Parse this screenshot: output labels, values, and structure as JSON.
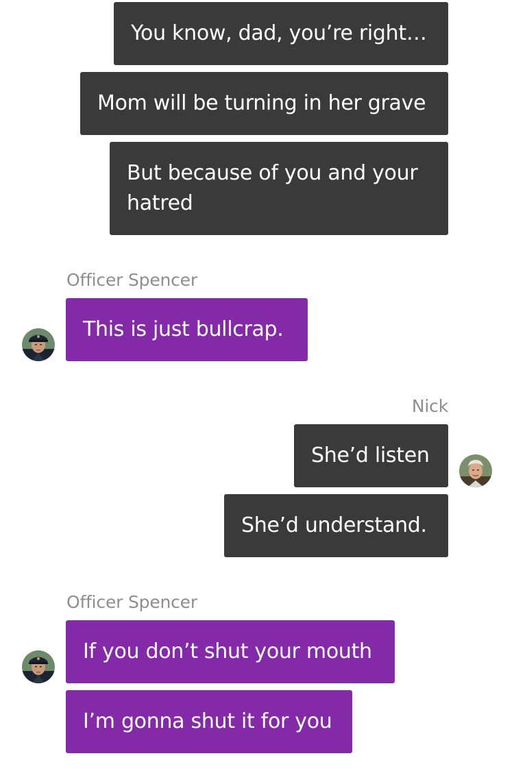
{
  "conversation": {
    "messages": [
      {
        "sender": "",
        "text": "You know, dad, you’re right…",
        "side": "outgoing"
      },
      {
        "sender": "",
        "text": "Mom will be turning in her grave",
        "side": "outgoing"
      },
      {
        "sender": "",
        "text": "But because of you and your hatred",
        "side": "outgoing"
      },
      {
        "sender": "Officer Spencer",
        "text": "This is just bullcrap.",
        "side": "incoming"
      },
      {
        "sender": "Nick",
        "text": "She’d listen",
        "side": "outgoing"
      },
      {
        "sender": "",
        "text": "She’d understand.",
        "side": "outgoing"
      },
      {
        "sender": "Officer Spencer",
        "text": "If you don’t shut your mouth",
        "side": "incoming"
      },
      {
        "sender": "",
        "text": "I’m gonna shut it for you",
        "side": "incoming"
      }
    ]
  },
  "avatars": {
    "officer_spencer": "officer-avatar-icon",
    "nick": "nick-avatar-icon"
  },
  "colors": {
    "outgoing_bubble": "#3a3a3a",
    "incoming_bubble": "#8429a8",
    "sender_label": "#8e8e8e",
    "background": "#ffffff"
  }
}
